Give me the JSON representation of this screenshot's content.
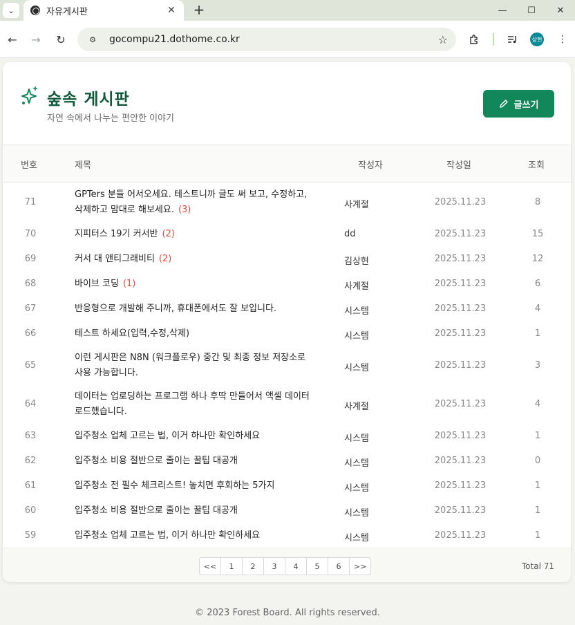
{
  "browser": {
    "tab_title": "자유게시판",
    "url": "gocompu21.dothome.co.kr",
    "profile_initials": "상현"
  },
  "board": {
    "title": "숲속 게시판",
    "subtitle": "자연 속에서 나누는 편안한 이야기",
    "write_label": "글쓰기"
  },
  "table": {
    "headers": {
      "num": "번호",
      "title": "제목",
      "author": "작성자",
      "date": "작성일",
      "views": "조회"
    },
    "rows": [
      {
        "num": "71",
        "title": "GPTers 분들 어서오세요. 테스트니까 글도 써 보고, 수정하고, 삭제하고 맘대로 해보세요.",
        "comments": "(3)",
        "author": "사계절",
        "date": "2025.11.23",
        "views": "8"
      },
      {
        "num": "70",
        "title": "지피터스 19기 커서반",
        "comments": "(2)",
        "author": "dd",
        "date": "2025.11.23",
        "views": "15"
      },
      {
        "num": "69",
        "title": "커서 대 앤티그래비티",
        "comments": "(2)",
        "author": "김상현",
        "date": "2025.11.23",
        "views": "12"
      },
      {
        "num": "68",
        "title": "바이브 코딩",
        "comments": "(1)",
        "author": "사계절",
        "date": "2025.11.23",
        "views": "6"
      },
      {
        "num": "67",
        "title": "반응형으로 개발해 주니까, 휴대폰에서도 잘 보입니다.",
        "comments": "",
        "author": "시스템",
        "date": "2025.11.23",
        "views": "4"
      },
      {
        "num": "66",
        "title": "테스트 하세요(입력,수정,삭제)",
        "comments": "",
        "author": "시스템",
        "date": "2025.11.23",
        "views": "1"
      },
      {
        "num": "65",
        "title": "이런 게시판은 N8N (워크플로우) 중간 및 최종 정보 저장소로 사용 가능합니다.",
        "comments": "",
        "author": "시스템",
        "date": "2025.11.23",
        "views": "3"
      },
      {
        "num": "64",
        "title": "데이터는 업로딩하는 프로그램 하나 후딱 만들어서 액셀 데이터 로드했습니다.",
        "comments": "",
        "author": "사계절",
        "date": "2025.11.23",
        "views": "4"
      },
      {
        "num": "63",
        "title": "입주청소 업체 고르는 법, 이거 하나만 확인하세요",
        "comments": "",
        "author": "시스템",
        "date": "2025.11.23",
        "views": "1"
      },
      {
        "num": "62",
        "title": "입주청소 비용 절반으로 줄이는 꿀팁 대공개",
        "comments": "",
        "author": "시스템",
        "date": "2025.11.23",
        "views": "0"
      },
      {
        "num": "61",
        "title": "입주청소 전 필수 체크리스트! 놓치면 후회하는 5가지",
        "comments": "",
        "author": "시스템",
        "date": "2025.11.23",
        "views": "1"
      },
      {
        "num": "60",
        "title": "입주청소 비용 절반으로 줄이는 꿀팁 대공개",
        "comments": "",
        "author": "시스템",
        "date": "2025.11.23",
        "views": "1"
      },
      {
        "num": "59",
        "title": "입주청소 업체 고르는 법, 이거 하나만 확인하세요",
        "comments": "",
        "author": "시스템",
        "date": "2025.11.23",
        "views": "1"
      }
    ]
  },
  "pagination": {
    "first": "<<",
    "pages": [
      "1",
      "2",
      "3",
      "4",
      "5",
      "6"
    ],
    "last": ">>",
    "total": "Total 71"
  },
  "footer": {
    "copyright": "© 2023 Forest Board. All rights reserved."
  },
  "colors": {
    "accent": "#11875a",
    "title": "#0f5a3a",
    "comment": "#e04a3a"
  }
}
